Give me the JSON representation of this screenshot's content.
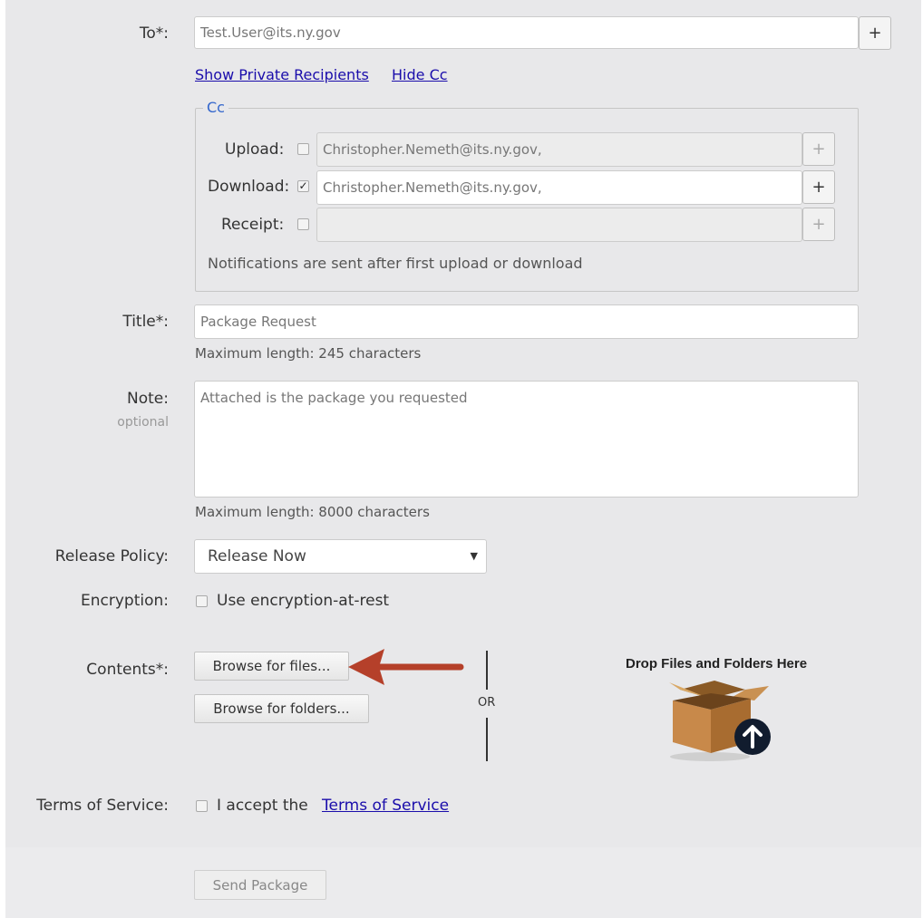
{
  "to": {
    "label": "To*:",
    "value": "Test.User@its.ny.gov",
    "add_label": "+"
  },
  "links": {
    "show_private": "Show Private Recipients",
    "hide_cc": "Hide Cc"
  },
  "cc": {
    "legend": "Cc",
    "rows": [
      {
        "label": "Upload:",
        "checked": false,
        "value": "Christopher.Nemeth@its.ny.gov,",
        "add_label": "+"
      },
      {
        "label": "Download:",
        "checked": true,
        "value": "Christopher.Nemeth@its.ny.gov,",
        "add_label": "+"
      },
      {
        "label": "Receipt:",
        "checked": false,
        "value": "",
        "add_label": "+"
      }
    ],
    "note": "Notifications are sent after first upload or download"
  },
  "title": {
    "label": "Title*:",
    "value": "Package Request",
    "hint": "Maximum length: 245 characters"
  },
  "note": {
    "label": "Note:",
    "sublabel": "optional",
    "value": "Attached is the package you requested",
    "hint": "Maximum length: 8000 characters"
  },
  "release_policy": {
    "label": "Release Policy:",
    "selected": "Release Now"
  },
  "encryption": {
    "label": "Encryption:",
    "option": "Use encryption-at-rest",
    "checked": false
  },
  "contents": {
    "label": "Contents*:",
    "browse_files": "Browse for files...",
    "browse_folders": "Browse for folders...",
    "or": "OR",
    "drop_text": "Drop Files and Folders Here"
  },
  "terms": {
    "label": "Terms of Service:",
    "prefix": "I accept the ",
    "link": "Terms of Service",
    "checked": false
  },
  "send_button": "Send Package",
  "colors": {
    "link": "#1a0dab",
    "legend": "#3366cc",
    "arrow": "#b5402a",
    "panel": "#e8e8ea"
  },
  "icons": {
    "arrow": "red-arrow-annotation",
    "drop": "box-upload-icon"
  }
}
